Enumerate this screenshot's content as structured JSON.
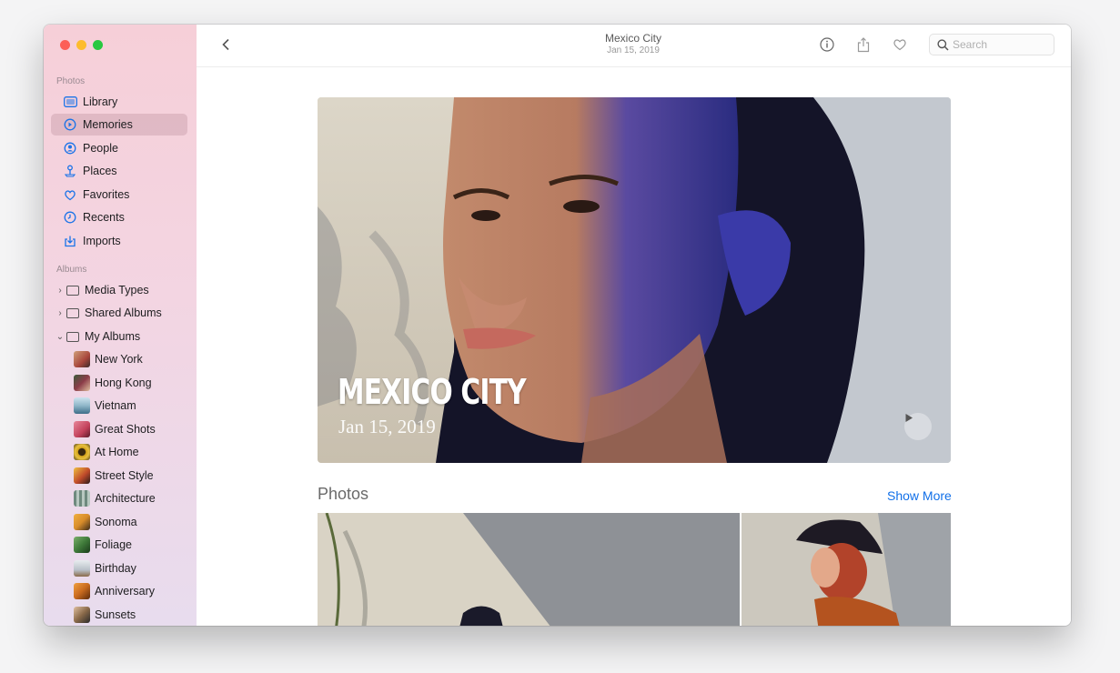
{
  "window": {
    "traffic_lights": [
      "close",
      "minimize",
      "zoom"
    ]
  },
  "sidebar": {
    "photos_header": "Photos",
    "photos_items": [
      {
        "label": "Library",
        "icon": "library-icon",
        "selected": false
      },
      {
        "label": "Memories",
        "icon": "memories-icon",
        "selected": true
      },
      {
        "label": "People",
        "icon": "people-icon",
        "selected": false
      },
      {
        "label": "Places",
        "icon": "places-icon",
        "selected": false
      },
      {
        "label": "Favorites",
        "icon": "heart-icon",
        "selected": false
      },
      {
        "label": "Recents",
        "icon": "clock-icon",
        "selected": false
      },
      {
        "label": "Imports",
        "icon": "import-icon",
        "selected": false
      }
    ],
    "albums_header": "Albums",
    "album_groups": [
      {
        "label": "Media Types",
        "expanded": false
      },
      {
        "label": "Shared Albums",
        "expanded": false
      },
      {
        "label": "My Albums",
        "expanded": true
      }
    ],
    "albums": [
      {
        "label": "New York",
        "color": "#a8463c"
      },
      {
        "label": "Hong Kong",
        "color": "#8b3c48"
      },
      {
        "label": "Vietnam",
        "color": "#8fb7c9"
      },
      {
        "label": "Great Shots",
        "color": "#c2405a"
      },
      {
        "label": "At Home",
        "color": "#d3a21a"
      },
      {
        "label": "Street Style",
        "color": "#c04a2a"
      },
      {
        "label": "Architecture",
        "color": "#6f8a7e"
      },
      {
        "label": "Sonoma",
        "color": "#d88c2a"
      },
      {
        "label": "Foliage",
        "color": "#3f7a3a"
      },
      {
        "label": "Birthday",
        "color": "#b8c0c8"
      },
      {
        "label": "Anniversary",
        "color": "#c96a1e"
      },
      {
        "label": "Sunsets",
        "color": "#8a6a4a"
      }
    ]
  },
  "toolbar": {
    "title": "Mexico City",
    "subtitle": "Jan 15, 2019",
    "search_placeholder": "Search"
  },
  "memory": {
    "title": "MEXICO CITY",
    "date": "Jan 15, 2019"
  },
  "photos_section": {
    "header": "Photos",
    "show_more": "Show More"
  },
  "colors": {
    "accent": "#1270e8",
    "sidebar_top": "#f6cfd8",
    "sidebar_bottom": "#e8dcee"
  }
}
